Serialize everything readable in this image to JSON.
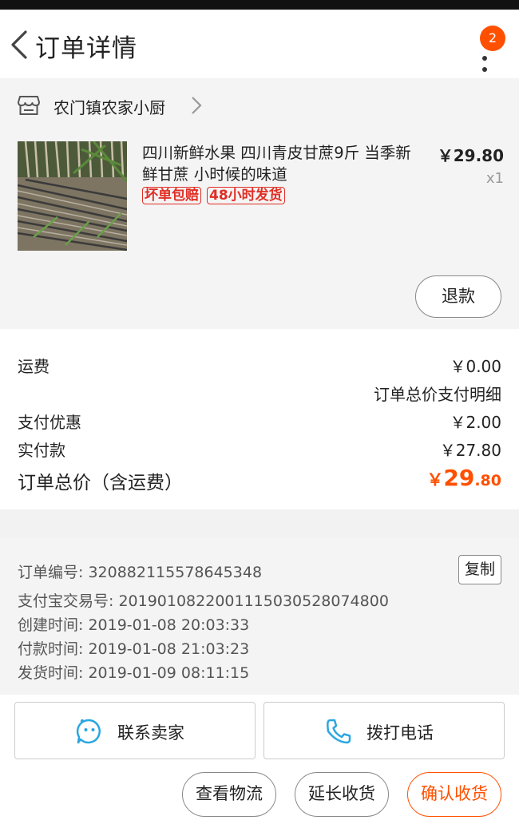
{
  "header": {
    "title": "订单详情",
    "badge_count": "2"
  },
  "shop": {
    "name": "农门镇农家小厨"
  },
  "product": {
    "title": "四川新鲜水果 四川青皮甘蔗9斤 当季新鲜甘蔗 小时候的味道",
    "tags": [
      "坏单包赔",
      "48小时发货"
    ],
    "price": "￥29.80",
    "quantity": "x1",
    "refund_label": "退款"
  },
  "fees": {
    "shipping_label": "运费",
    "shipping_value": "￥0.00",
    "payment_detail_link": "订单总价支付明细",
    "discount_label": "支付优惠",
    "discount_value": "￥2.00",
    "paid_label": "实付款",
    "paid_value": "￥27.80",
    "total_label": "订单总价（含运费）",
    "total_symbol": "￥",
    "total_integer": "29",
    "total_decimal": ".80"
  },
  "order_info": {
    "order_number": "订单编号: 320882115578645348",
    "copy_label": "复制",
    "alipay_txn": "支付宝交易号: 2019010822001115030528074800",
    "created": "创建时间: 2019-01-08 20:03:33",
    "paid": "付款时间: 2019-01-08 21:03:23",
    "shipped": "发货时间: 2019-01-09 08:11:15"
  },
  "contact": {
    "seller_label": "联系卖家",
    "call_label": "拨打电话"
  },
  "actions": {
    "logistics": "查看物流",
    "extend": "延长收货",
    "confirm": "确认收货"
  },
  "colors": {
    "accent": "#ff5000",
    "tag_red": "#e02e24",
    "icon_blue": "#2aa7e0"
  }
}
